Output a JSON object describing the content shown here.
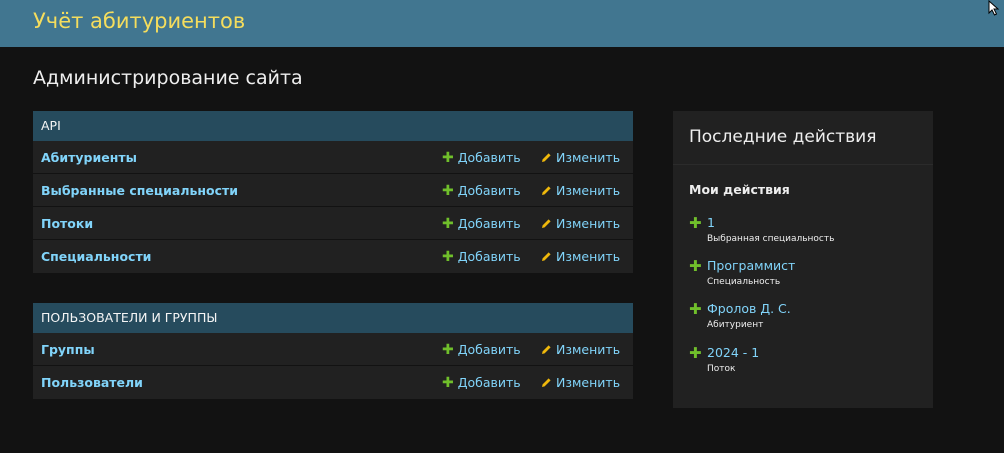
{
  "header": {
    "site_title": "Учёт абитуриентов"
  },
  "page": {
    "title": "Администрирование сайта"
  },
  "modules": [
    {
      "caption": "API",
      "rows": [
        {
          "name": "Абитуриенты",
          "add": "Добавить",
          "change": "Изменить"
        },
        {
          "name": "Выбранные специальности",
          "add": "Добавить",
          "change": "Изменить"
        },
        {
          "name": "Потоки",
          "add": "Добавить",
          "change": "Изменить"
        },
        {
          "name": "Специальности",
          "add": "Добавить",
          "change": "Изменить"
        }
      ]
    },
    {
      "caption": "ПОЛЬЗОВАТЕЛИ И ГРУППЫ",
      "rows": [
        {
          "name": "Группы",
          "add": "Добавить",
          "change": "Изменить"
        },
        {
          "name": "Пользователи",
          "add": "Добавить",
          "change": "Изменить"
        }
      ]
    }
  ],
  "recent": {
    "title": "Последние действия",
    "my_actions": "Мои действия",
    "items": [
      {
        "label": "1",
        "type": "Выбранная специальность"
      },
      {
        "label": "Программист",
        "type": "Специальность"
      },
      {
        "label": "Фролов Д. С.",
        "type": "Абитуриент"
      },
      {
        "label": "2024 - 1",
        "type": "Поток"
      }
    ]
  },
  "icons": {
    "add": "plus-icon",
    "change": "pencil-icon",
    "cursor": "mouse-cursor-icon"
  },
  "colors": {
    "header_bg": "#417690",
    "title_yellow": "#f5dd5d",
    "link_blue": "#81d4fa",
    "caption_bg": "#264b5d",
    "add_green": "#70bf2b",
    "pencil_yellow": "#efb80b"
  }
}
